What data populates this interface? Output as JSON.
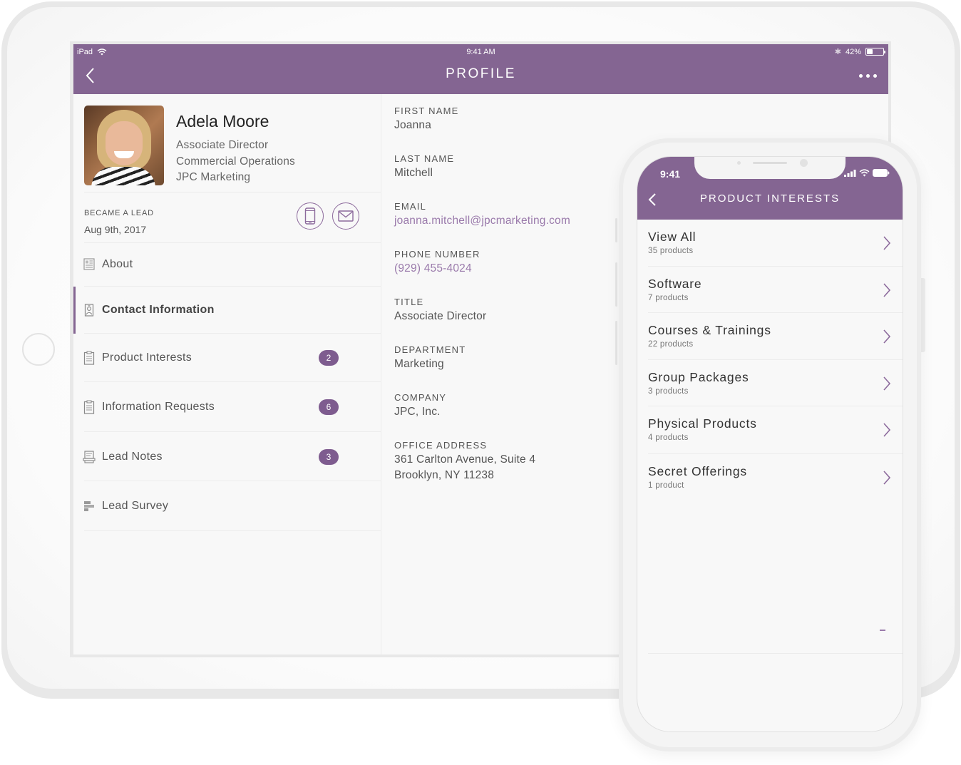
{
  "ipad": {
    "status_bar": {
      "device": "iPad",
      "time": "9:41 AM",
      "battery_percent_label": "42%",
      "battery_level": 0.42
    },
    "nav": {
      "title": "PROFILE",
      "back_icon": "chevron-left-icon",
      "more_icon": "more-horizontal-icon"
    },
    "profile": {
      "name": "Adela Moore",
      "title": "Associate Director",
      "department": "Commercial Operations",
      "company": "JPC Marketing",
      "became_lead_label": "BECAME A LEAD",
      "became_lead_date": "Aug 9th, 2017",
      "actions": [
        {
          "name": "call",
          "icon": "mobile-phone-icon"
        },
        {
          "name": "email",
          "icon": "envelope-icon"
        }
      ]
    },
    "menu": [
      {
        "label": "About",
        "icon": "newspaper-icon",
        "badge": null,
        "active": false
      },
      {
        "label": "Contact Information",
        "icon": "id-badge-icon",
        "badge": null,
        "active": true
      },
      {
        "label": "Product Interests",
        "icon": "clipboard-checklist-icon",
        "badge": "2",
        "active": false
      },
      {
        "label": "Information Requests",
        "icon": "clipboard-checklist-icon",
        "badge": "6",
        "active": false
      },
      {
        "label": "Lead Notes",
        "icon": "notepad-icon",
        "badge": "3",
        "active": false
      },
      {
        "label": "Lead Survey",
        "icon": "bar-survey-icon",
        "badge": null,
        "active": false
      }
    ],
    "contact": {
      "fields": [
        {
          "label": "FIRST NAME",
          "value": "Joanna"
        },
        {
          "label": "LAST NAME",
          "value": "Mitchell"
        },
        {
          "label": "EMAIL",
          "value": "joanna.mitchell@jpcmarketing.com"
        },
        {
          "label": "PHONE NUMBER",
          "value": "(929) 455-4024"
        },
        {
          "label": "TITLE",
          "value": "Associate Director"
        },
        {
          "label": "DEPARTMENT",
          "value": "Marketing"
        },
        {
          "label": "COMPANY",
          "value": "JPC, Inc."
        },
        {
          "label": "OFFICE ADDRESS",
          "value_line1": "361 Carlton Avenue, Suite 4",
          "value_line2": "Brooklyn, NY 11238"
        }
      ]
    }
  },
  "iphone": {
    "status_bar": {
      "time": "9:41"
    },
    "nav": {
      "title": "PRODUCT INTERESTS",
      "back_icon": "chevron-left-icon"
    },
    "items": [
      {
        "title": "View All",
        "count": "35 products"
      },
      {
        "title": "Software",
        "count": "7 products"
      },
      {
        "title": "Courses & Trainings",
        "count": "22 products"
      },
      {
        "title": "Group Packages",
        "count": "3 products"
      },
      {
        "title": "Physical Products",
        "count": "4 products"
      },
      {
        "title": "Secret Offerings",
        "count": "1 product"
      }
    ]
  },
  "colors": {
    "brand_purple": "#846592",
    "badge_purple": "#7e5c8f",
    "link_purple": "#9a7aab",
    "background": "#f8f8f8"
  }
}
